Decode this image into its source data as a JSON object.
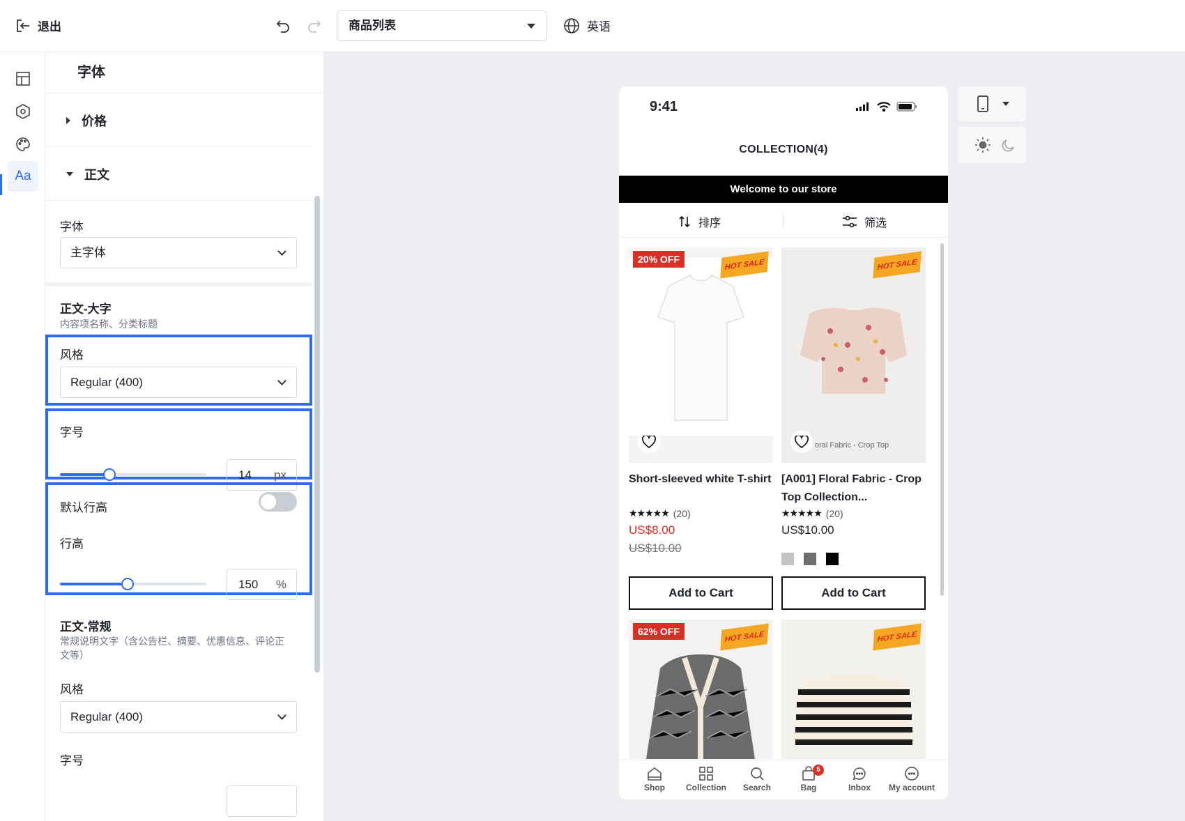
{
  "topbar": {
    "exit_label": "退出",
    "page_select": "商品列表",
    "language_label": "英语"
  },
  "panel": {
    "title": "字体",
    "accordion_price": "价格",
    "accordion_body": "正文",
    "font_label": "字体",
    "font_value": "主字体",
    "body_large": {
      "title": "正文-大字",
      "desc": "内容项名称、分类标题",
      "style_label": "风格",
      "style_value": "Regular (400)",
      "size_label": "字号",
      "size_value": "14",
      "size_unit": "px",
      "size_fraction": 0.34,
      "default_lh_label": "默认行高",
      "default_lh_on": false,
      "lh_label": "行高",
      "lh_value": "150",
      "lh_unit": "%",
      "lh_fraction": 0.46
    },
    "body_regular": {
      "title": "正文-常规",
      "desc": "常规说明文字（含公告栏、摘要、优惠信息、评论正文等）",
      "style_label": "风格",
      "style_value": "Regular (400)",
      "size_label": "字号"
    }
  },
  "phone": {
    "time": "9:41",
    "title": "COLLECTION(4)",
    "banner": "Welcome to our store",
    "sort_label": "排序",
    "filter_label": "筛选",
    "products": [
      {
        "badge": "20% OFF",
        "hot": "HOT SALE",
        "title": "Short-sleeved white T-shirt",
        "rating": "★★★★★",
        "reviews": "(20)",
        "price": "US$8.00",
        "old_price": "US$10.00",
        "button": "Add to Cart",
        "img_caption": ""
      },
      {
        "badge": "",
        "hot": "HOT SALE",
        "title": "[A001] Floral Fabric - Crop Top Collection...",
        "rating": "★★★★★",
        "reviews": "(20)",
        "price": "US$10.00",
        "old_price": "",
        "button": "Add to Cart",
        "img_caption": "oral Fabric - Crop Top"
      },
      {
        "badge": "62% OFF",
        "hot": "HOT SALE"
      },
      {
        "badge": "",
        "hot": "HOT SALE"
      }
    ],
    "swatch_colors": [
      "#c4c4c4",
      "#6e6e6e",
      "#000000"
    ],
    "sale_price_color": "#d93025",
    "tabs": [
      {
        "label": "Shop",
        "icon": "home-icon"
      },
      {
        "label": "Collection",
        "icon": "grid-icon"
      },
      {
        "label": "Search",
        "icon": "search-icon"
      },
      {
        "label": "Bag",
        "icon": "bag-icon",
        "badge": "5"
      },
      {
        "label": "Inbox",
        "icon": "chat-icon"
      },
      {
        "label": "My account",
        "icon": "account-icon"
      }
    ]
  },
  "colors": {
    "accent": "#2f6bf2",
    "canvas_bg": "#eceef2"
  }
}
